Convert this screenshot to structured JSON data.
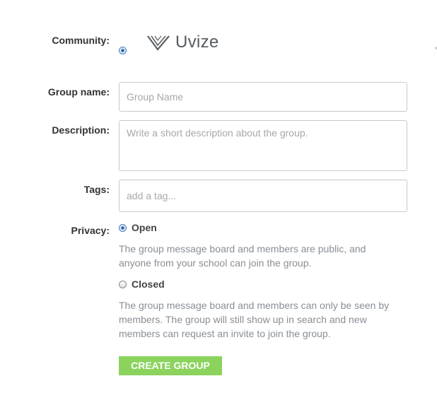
{
  "community": {
    "label": "Community:",
    "logo_text": "Uvize",
    "selected": true
  },
  "group_name": {
    "label": "Group name:",
    "placeholder": "Group Name",
    "value": ""
  },
  "description": {
    "label": "Description:",
    "placeholder": "Write a short description about the group.",
    "value": ""
  },
  "tags": {
    "label": "Tags:",
    "placeholder": "add a tag...",
    "value": ""
  },
  "privacy": {
    "label": "Privacy:",
    "selected": "Open",
    "options": [
      {
        "label": "Open",
        "checked": true,
        "description_lines": [
          "The group message board and members are public, and",
          "anyone from your school can join the group."
        ]
      },
      {
        "label": "Closed",
        "checked": false,
        "description_lines": [
          "The group message board and members can only be seen by",
          "members. The group will still show up in search and new",
          "members can request an invite to join the group."
        ]
      }
    ]
  },
  "actions": {
    "create_label": "CREATE GROUP"
  },
  "colors": {
    "button_green": "#8bd35d",
    "help_text": "#888f96",
    "radio_accent": "#2a5fa8"
  },
  "icons": {
    "logo": "uvize-logo-icon",
    "radio": "radio-button-icon"
  }
}
